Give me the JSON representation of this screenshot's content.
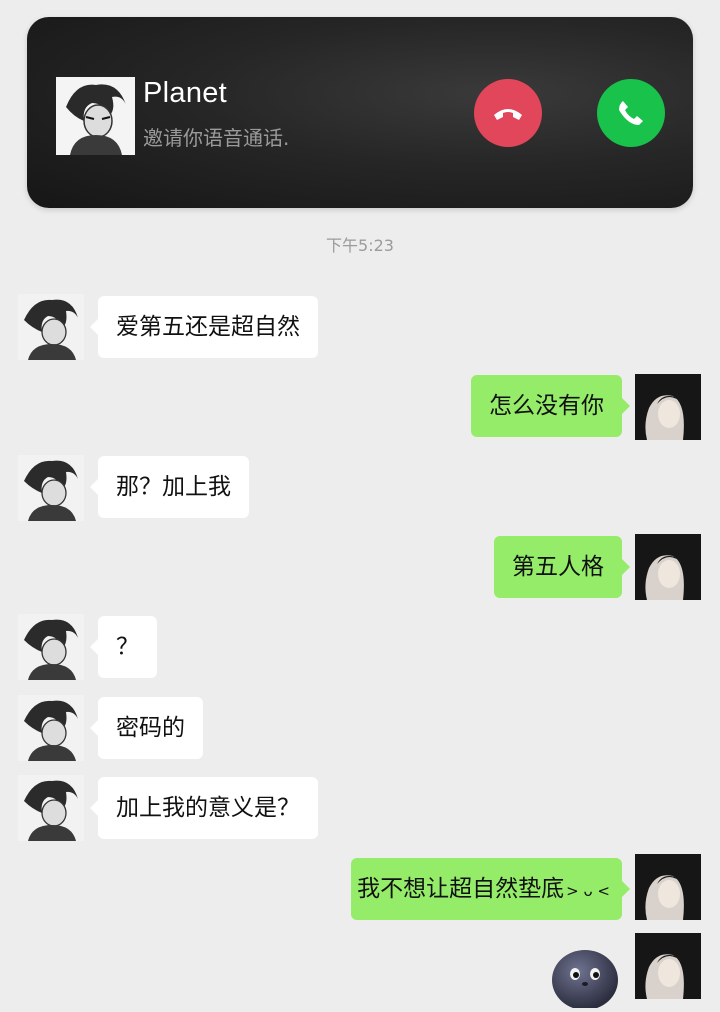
{
  "call": {
    "caller_name": "Planet",
    "subtitle": "邀请你语音通话.",
    "decline_icon": "phone-hangup-icon",
    "accept_icon": "phone-icon",
    "decline_color": "#e2465a",
    "accept_color": "#19c24a"
  },
  "timestamp": "下午5:23",
  "colors": {
    "incoming_bubble": "#ffffff",
    "outgoing_bubble": "#95ec69",
    "background": "#ededed"
  },
  "messages": [
    {
      "side": "in",
      "text": "爱第五还是超自然"
    },
    {
      "side": "out",
      "text": "怎么没有你"
    },
    {
      "side": "in",
      "text": "那？加上我"
    },
    {
      "side": "out",
      "text": "第五人格"
    },
    {
      "side": "in",
      "text": "？"
    },
    {
      "side": "in",
      "text": "密码的"
    },
    {
      "side": "in",
      "text": "加上我的意义是？"
    },
    {
      "side": "out",
      "text": "我不想让超自然垫底",
      "emoticon": "> ᴗ <"
    },
    {
      "side": "out",
      "sticker": "moon-face-sticker"
    }
  ]
}
